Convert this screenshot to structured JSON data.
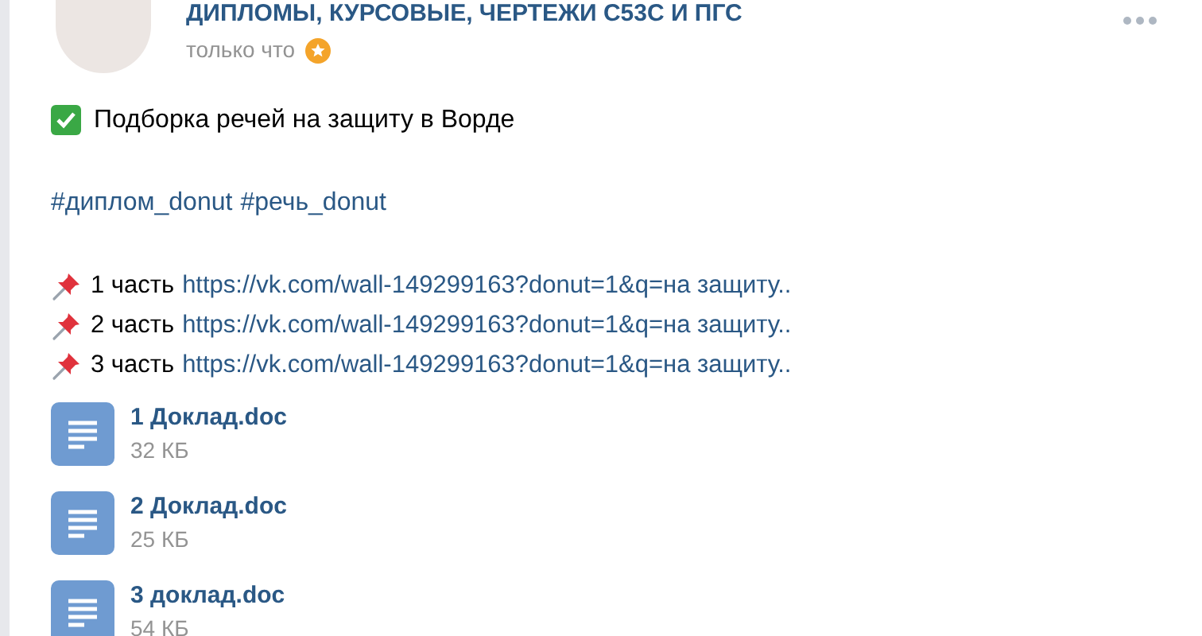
{
  "post": {
    "author": "ДИПЛОМЫ, КУРСОВЫЕ, ЧЕРТЕЖИ С53С И ПГС",
    "time": "только что",
    "donut": true,
    "title": "Подборка речей на защиту в Ворде",
    "hashtags": [
      "#диплом_donut",
      "#речь_donut"
    ],
    "parts": [
      {
        "label": "1 часть",
        "link": "https://vk.com/wall-149299163?donut=1&q=на защиту.."
      },
      {
        "label": "2 часть",
        "link": "https://vk.com/wall-149299163?donut=1&q=на защиту.."
      },
      {
        "label": "3 часть",
        "link": "https://vk.com/wall-149299163?donut=1&q=на защиту.."
      }
    ],
    "documents": [
      {
        "name": "1 Доклад.doc",
        "size": "32 КБ"
      },
      {
        "name": "2 Доклад.doc",
        "size": "25 КБ"
      },
      {
        "name": "3 доклад.doc",
        "size": "54 КБ"
      }
    ]
  }
}
